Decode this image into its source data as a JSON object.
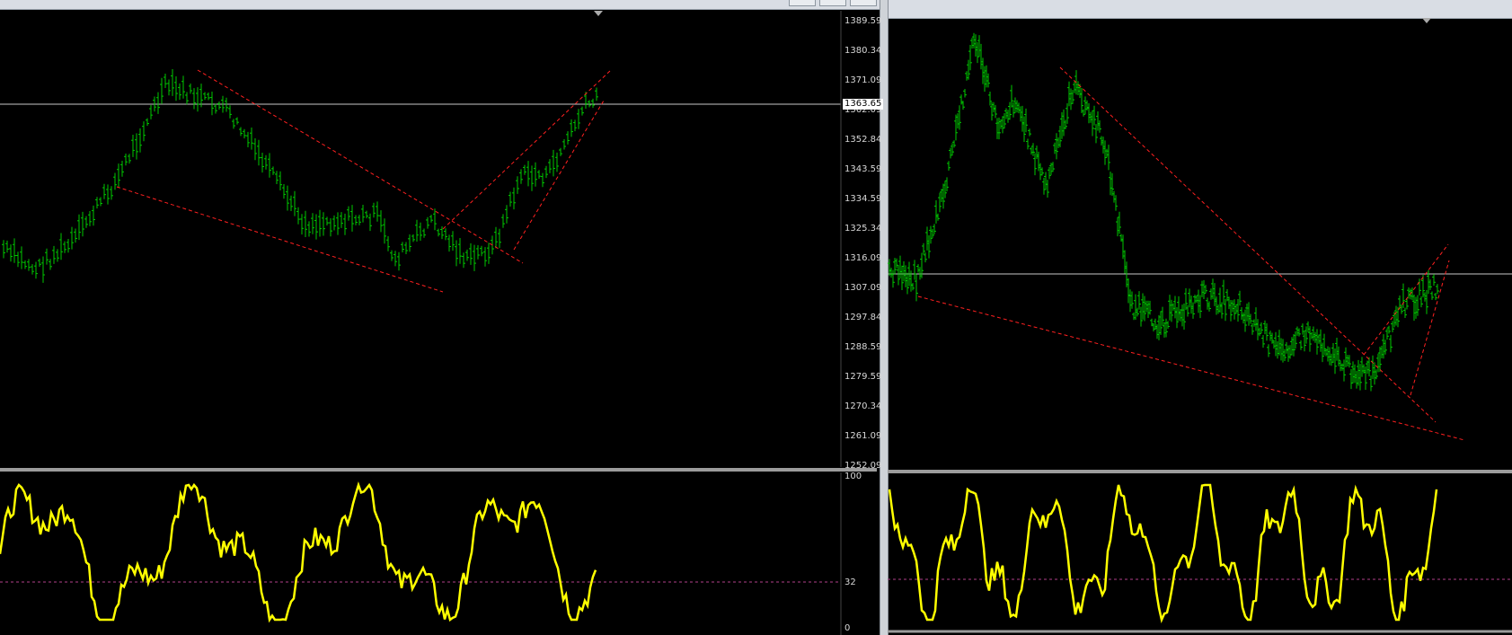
{
  "left_chart": {
    "price_scale": [
      "1389.59",
      "1380.34",
      "1371.09",
      "1362.09",
      "1352.84",
      "1343.59",
      "1334.59",
      "1325.34",
      "1316.09",
      "1307.09",
      "1297.84",
      "1288.59",
      "1279.59",
      "1270.34",
      "1261.09",
      "1252.09"
    ],
    "current_price": "1363.65",
    "oscillator_scale": {
      "top": "100",
      "mid": "32",
      "bottom": "0"
    }
  },
  "right_chart": {},
  "colors": {
    "background": "#000000",
    "candles": "#00c800",
    "trendlines": "#ff2020",
    "oscillator": "#ffff00",
    "level_line": "#c8c8c8",
    "oscillator_level": "#b0408a"
  }
}
